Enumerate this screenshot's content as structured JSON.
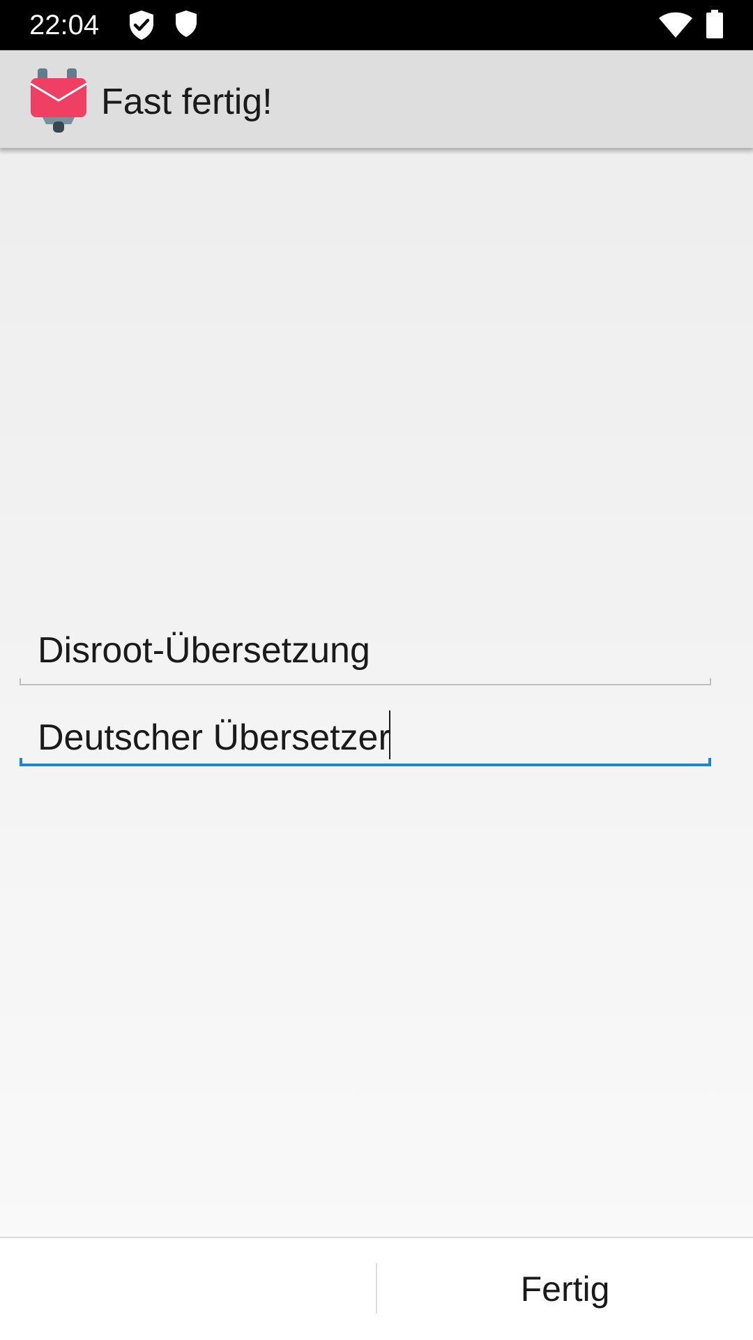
{
  "status_bar": {
    "time": "22:04",
    "icons": [
      "shield-check-icon",
      "shield-icon",
      "wifi-icon",
      "battery-icon"
    ]
  },
  "app_bar": {
    "logo_icon": "k9-mail-logo-icon",
    "title": "Fast fertig!"
  },
  "form": {
    "account_name": {
      "value": "Disroot-Übersetzung"
    },
    "your_name": {
      "value": "Deutscher Übersetzer"
    }
  },
  "footer": {
    "done_label": "Fertig"
  },
  "colors": {
    "status_bar": "#000000",
    "app_bar": "#dedede",
    "focus_accent": "#1e88c6",
    "logo_envelope": "#ef3f62",
    "logo_body": "#78909c"
  }
}
